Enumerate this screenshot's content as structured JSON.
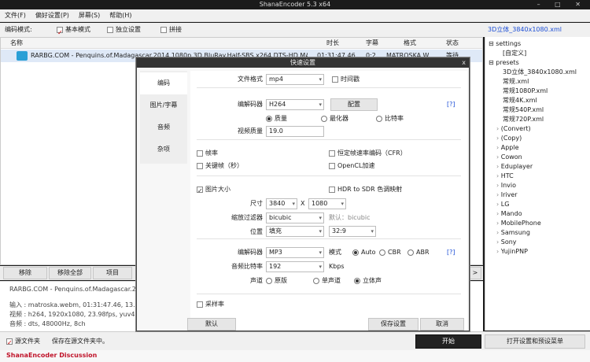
{
  "window": {
    "title": "ShanaEncoder 5.3 x64",
    "controls": "–  □  ✕"
  },
  "menu": [
    "文件(F)",
    "偏好设置(P)",
    "屏幕(S)",
    "帮助(H)"
  ],
  "mode": {
    "label": "编码模式:",
    "basic": "基本模式",
    "independent": "独立设置",
    "splice": "拼接",
    "preset_link": "3D立体_3840x1080.xml"
  },
  "table": {
    "headers": [
      "名称",
      "时长",
      "字幕",
      "格式",
      "状态"
    ],
    "rows": [
      {
        "name": "RARBG.COM - Penquins.of.Madagascar.2014.1080p.3D.BluRay.Half-SBS.x264.DTS-HD.MA.7.1-RARBG...",
        "duration": "01:31:47.46",
        "subtitle": "0:2",
        "format": "MATROSKA.W...",
        "status": "等待"
      }
    ]
  },
  "tree": {
    "settings": "settings",
    "custom": "[自定义]",
    "presets": "presets",
    "items": [
      "3D立体_3840x1080.xml",
      "常规.xml",
      "常规1080P.xml",
      "常规4K.xml",
      "常规540P.xml",
      "常规720P.xml",
      "(Convert)",
      "(Copy)",
      "Apple",
      "Cowon",
      "Eduplayer",
      "HTC",
      "Invio",
      "Iriver",
      "LG",
      "Mando",
      "MobilePhone",
      "Samsung",
      "Sony",
      "YujinPNP"
    ]
  },
  "buttons": {
    "remove": "移除",
    "remove_all": "移除全部",
    "item": "项目",
    "arrow": ">"
  },
  "info": {
    "title": "RARBG.COM - Penquins.of.Madagascar.2014.1",
    "input": "输入 : matroska.webm, 01:31:47.46, 13.34GB",
    "video": "视频 : h264, 1920x1080, 23.98fps, yuv420p(tv",
    "audio": "音频 : dts, 48000Hz, 8ch"
  },
  "bottom": {
    "source_folder": "源文件夹",
    "save_to_source": "保存在源文件夹中。",
    "start": "开始",
    "open_settings": "打开设置和预设菜单"
  },
  "footer": {
    "brand": "ShanaEncoder Discussion"
  },
  "dialog": {
    "title": "快速设置",
    "close": "x",
    "tabs": [
      "编码",
      "图片/字幕",
      "音频",
      "杂项"
    ],
    "file_format_label": "文件格式",
    "file_format": "mp4",
    "timestamp": "时间戳",
    "codec_label": "编解码器",
    "codec": "H264",
    "config": "配置",
    "help": "[?]",
    "modes": [
      "质量",
      "最化器",
      "比特率"
    ],
    "quality_label": "视频质量",
    "quality": "19.0",
    "framerate": "帧率",
    "cfr": "恒定帧速率编码（CFR）",
    "keyframe": "关键帧（秒）",
    "opencl": "OpenCL加速",
    "image_size": "图片大小",
    "hdr": "HDR to SDR 色调映射",
    "size_label": "尺寸",
    "width": "3840",
    "x": "X",
    "height": "1080",
    "filter_label": "缩放过滤器",
    "filter": "bicubic",
    "filter_default": "默认：bicubic",
    "position_label": "位置",
    "position": "填充",
    "aspect": "32:9",
    "audio_codec_label": "编解码器",
    "audio_codec": "MP3",
    "audio_mode_label": "模式",
    "audio_modes": [
      "Auto",
      "CBR",
      "ABR"
    ],
    "audio_help": "[?]",
    "bitrate_label": "音频比特率",
    "bitrate": "192",
    "bitrate_unit": "Kbps",
    "channel_label": "声道",
    "channels": [
      "原版",
      "单声道",
      "立体声"
    ],
    "sample_rate": "采样率",
    "default_btn": "默认",
    "save_btn": "保存设置",
    "cancel_btn": "取消"
  }
}
